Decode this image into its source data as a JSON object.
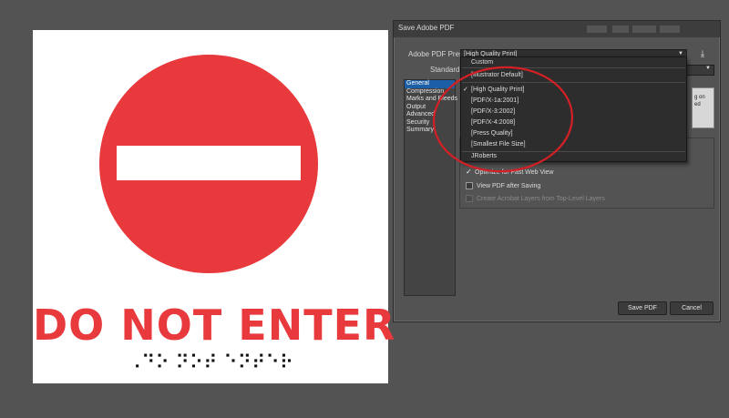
{
  "artboard": {
    "sign_text": "DO NOT ENTER",
    "sign_color": "#e8393c",
    "braille": "⠠⠙⠕ ⠝⠕⠞ ⠑⠝⠞⠑⠗"
  },
  "dialog": {
    "title": "Save Adobe PDF",
    "preset_label": "Adobe PDF Preset:",
    "preset_value": "[High Quality Print]",
    "standard_label": "Standard:",
    "nav": [
      "General",
      "Compression",
      "Marks and Bleeds",
      "Output",
      "Advanced",
      "Security",
      "Summary!"
    ],
    "description_fragment_1": "g on",
    "description_fragment_2": "ed",
    "options": [
      {
        "label": "Optimize for Fast Web View",
        "checked": true,
        "enabled": true
      },
      {
        "label": "View PDF after Saving",
        "checked": false,
        "enabled": true
      },
      {
        "label": "Create Acrobat Layers from Top-Level Layers",
        "checked": false,
        "enabled": false
      }
    ],
    "save_button": "Save PDF",
    "cancel_button": "Cancel"
  },
  "dropdown": {
    "items": [
      "Custom",
      "[Illustrator Default]",
      "[High Quality Print]",
      "[PDF/X-1a:2001]",
      "[PDF/X-3:2002]",
      "[PDF/X-4:2008]",
      "[Press Quality]",
      "[Smallest File Size]",
      "JRoberts"
    ],
    "selected_index": 2
  },
  "colors": {
    "annotation": "#d42025",
    "selection": "#1d5fa7"
  }
}
